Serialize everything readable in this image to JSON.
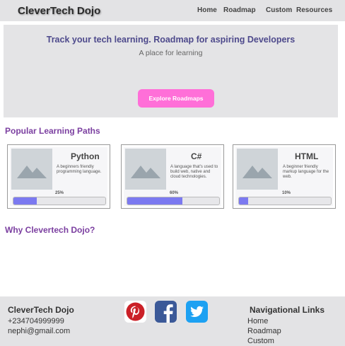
{
  "header": {
    "brand": "CleverTech Dojo",
    "nav": [
      "Home",
      "Roadmap",
      "Custom",
      "Resources"
    ]
  },
  "hero": {
    "title": "Track your tech learning. Roadmap for aspiring Developers",
    "subtitle": "A place for learning",
    "button": "Explore Roadmaps"
  },
  "popular": {
    "title": "Popular Learning Paths",
    "cards": [
      {
        "name": "Python",
        "desc": "A beginners friendly programming language.",
        "progress_label": "25%",
        "progress": 0.25
      },
      {
        "name": "C#",
        "desc": "A language that's used to build web, native and cloud technologies.",
        "progress_label": "60%",
        "progress": 0.6
      },
      {
        "name": "HTML",
        "desc": "A beginner friendly markup language for the web.",
        "progress_label": "10%",
        "progress": 0.1
      }
    ]
  },
  "why": {
    "title": "Why Clevertech Dojo?"
  },
  "footer": {
    "brand": "CleverTech Dojo",
    "phone": "+234704999999",
    "email": "nephi@gmail.com",
    "social": [
      "pinterest-icon",
      "facebook-icon",
      "twitter-icon"
    ],
    "links_title": "Navigational Links",
    "links": [
      "Home",
      "Roadmap",
      "Custom"
    ]
  },
  "colors": {
    "accent_pink": "#ff6fd8",
    "progress": "#7b79f0",
    "section_title": "#7b3fa0",
    "hero_title": "#4e4a8c"
  }
}
